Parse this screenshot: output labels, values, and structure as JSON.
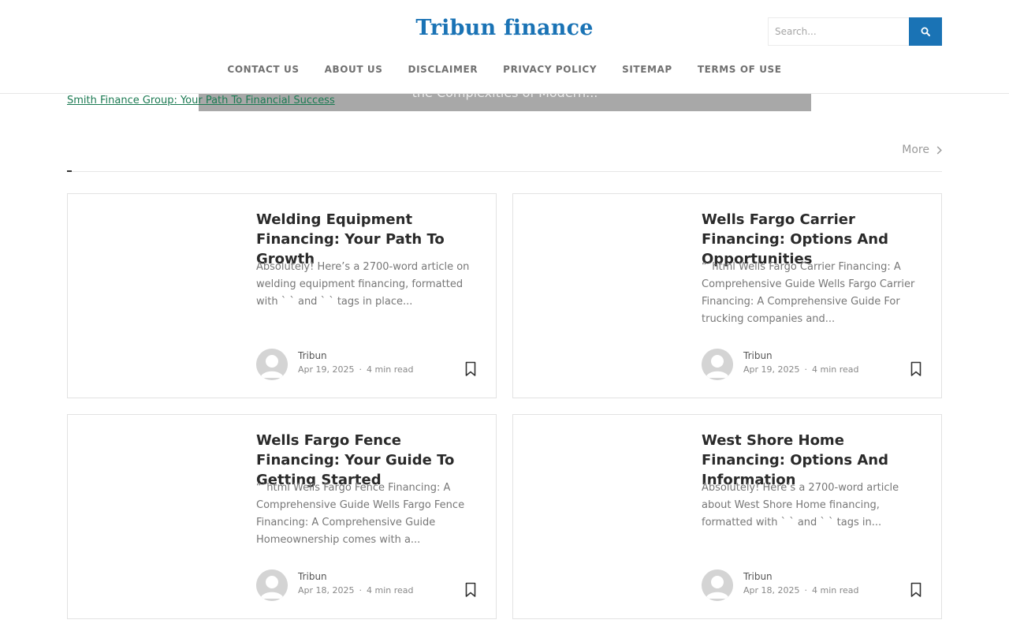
{
  "header": {
    "site_title": "Tribun finance",
    "search_placeholder": "Search...",
    "search_icon": "search-icon",
    "nav": [
      "CONTACT US",
      "ABOUT US",
      "DISCLAIMER",
      "PRIVACY POLICY",
      "SITEMAP",
      "TERMS OF USE"
    ]
  },
  "hero": {
    "image_alt": "Smith Finance Group: Your Path To Financial Success",
    "overlay_text": "the Complexities of Modern..."
  },
  "section": {
    "more_label": "More"
  },
  "posts": [
    {
      "title": "Welding Equipment Financing: Your Path To Growth",
      "excerpt": "Absolutely! Here’s a 2700-word article on welding equipment financing, formatted with ` ` and ` ` tags in place...",
      "author": "Tribun",
      "date": "Apr 19, 2025",
      "read_time": "4 min read"
    },
    {
      "title": "Wells Fargo Carrier Financing: Options And Opportunities",
      "excerpt": "“`html Wells Fargo Carrier Financing: A Comprehensive Guide Wells Fargo Carrier Financing: A Comprehensive Guide For trucking companies and...",
      "author": "Tribun",
      "date": "Apr 19, 2025",
      "read_time": "4 min read"
    },
    {
      "title": "Wells Fargo Fence Financing: Your Guide To Getting Started",
      "excerpt": "“`html Wells Fargo Fence Financing: A Comprehensive Guide Wells Fargo Fence Financing: A Comprehensive Guide Homeownership comes with a...",
      "author": "Tribun",
      "date": "Apr 18, 2025",
      "read_time": "4 min read"
    },
    {
      "title": "West Shore Home Financing: Options And Information",
      "excerpt": "Absolutely! Here’s a 2700-word article about West Shore Home financing, formatted with ` ` and ` ` tags in...",
      "author": "Tribun",
      "date": "Apr 18, 2025",
      "read_time": "4 min read"
    }
  ],
  "colors": {
    "brand": "#1a73b5",
    "nav_text": "#707070",
    "hero_alt_text": "#1b7a52"
  }
}
